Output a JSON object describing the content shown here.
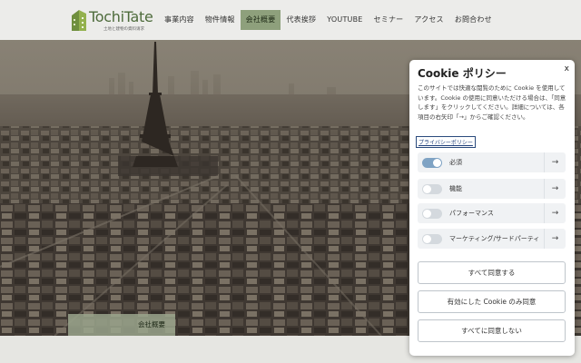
{
  "header": {
    "logo_text": "TochiTate",
    "logo_sub": "土地と建物の資料请求",
    "nav": [
      {
        "label": "事業内容",
        "active": false
      },
      {
        "label": "物件情報",
        "active": false
      },
      {
        "label": "会社概要",
        "active": true
      },
      {
        "label": "代表挨拶",
        "active": false
      },
      {
        "label": "YOUTUBE",
        "active": false
      },
      {
        "label": "セミナー",
        "active": false
      },
      {
        "label": "アクセス",
        "active": false
      },
      {
        "label": "お問合わせ",
        "active": false
      }
    ]
  },
  "hero": {
    "section_label": "会社概要"
  },
  "cookie": {
    "title": "Cookie ポリシー",
    "close": "x",
    "body": "このサイトでは快適な閲覧のために Cookie を使用しています。Cookie の使用に同意いただける場合は、「同意します」をクリックしてください。詳細については、各項目の右矢印「→」からご確認ください。",
    "privacy_link": "プライバシーポリシー",
    "categories": [
      {
        "label": "必須",
        "enabled": true,
        "arrow": "→"
      },
      {
        "label": "機能",
        "enabled": false,
        "arrow": "→"
      },
      {
        "label": "パフォーマンス",
        "enabled": false,
        "arrow": "→"
      },
      {
        "label": "マーケティング/サードパーティ",
        "enabled": false,
        "arrow": "→"
      }
    ],
    "buttons": {
      "accept_all": "すべて同意する",
      "accept_enabled": "有効にした Cookie のみ同意",
      "reject_all": "すべてに同意しない"
    }
  },
  "colors": {
    "accent_green": "#8ea07c",
    "toggle_on": "#7fa3c4",
    "logo_green": "#4d6b3b"
  }
}
